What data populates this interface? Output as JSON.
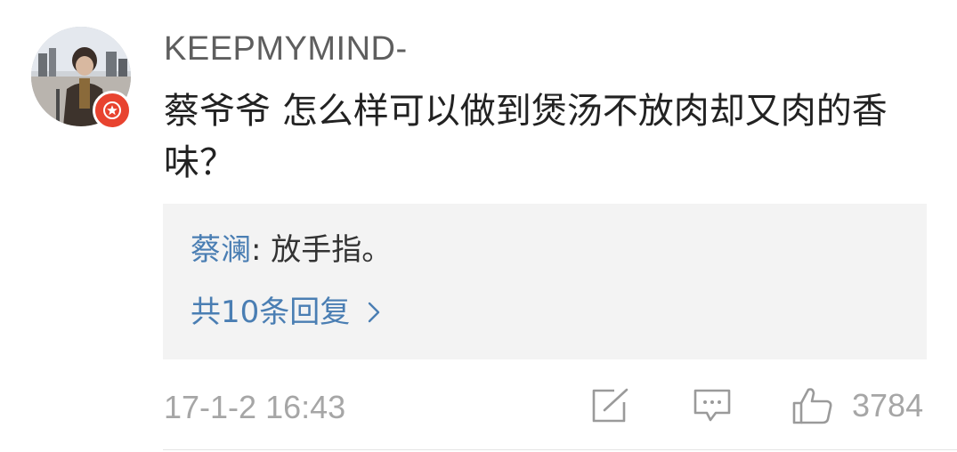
{
  "comment": {
    "username": "KEEPMYMIND-",
    "text": "蔡爷爷 怎么样可以做到煲汤不放肉却又肉的香味？",
    "timestamp": "17-1-2 16:43",
    "like_count": "3784"
  },
  "reply_box": {
    "reply_author": "蔡澜",
    "reply_separator": ": ",
    "reply_text": "放手指。",
    "more_replies_label": "共10条回复"
  },
  "icons": {
    "avatar": "user-avatar",
    "badge": "verified-star-icon",
    "more": "chevron-right-icon",
    "share": "share-icon",
    "comment": "comment-icon",
    "like": "thumbs-up-icon"
  },
  "colors": {
    "link": "#4a7eb3",
    "badge": "#e8432f",
    "reply_bg": "#f3f3f3",
    "meta": "#a6a6a6"
  }
}
